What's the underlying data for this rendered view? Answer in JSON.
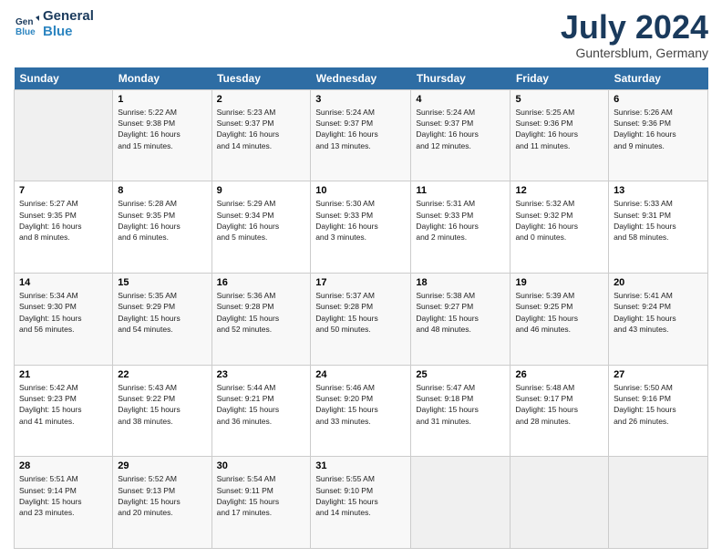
{
  "header": {
    "logo_line1": "General",
    "logo_line2": "Blue",
    "month": "July 2024",
    "location": "Guntersblum, Germany"
  },
  "weekdays": [
    "Sunday",
    "Monday",
    "Tuesday",
    "Wednesday",
    "Thursday",
    "Friday",
    "Saturday"
  ],
  "weeks": [
    [
      {
        "day": "",
        "info": ""
      },
      {
        "day": "1",
        "info": "Sunrise: 5:22 AM\nSunset: 9:38 PM\nDaylight: 16 hours\nand 15 minutes."
      },
      {
        "day": "2",
        "info": "Sunrise: 5:23 AM\nSunset: 9:37 PM\nDaylight: 16 hours\nand 14 minutes."
      },
      {
        "day": "3",
        "info": "Sunrise: 5:24 AM\nSunset: 9:37 PM\nDaylight: 16 hours\nand 13 minutes."
      },
      {
        "day": "4",
        "info": "Sunrise: 5:24 AM\nSunset: 9:37 PM\nDaylight: 16 hours\nand 12 minutes."
      },
      {
        "day": "5",
        "info": "Sunrise: 5:25 AM\nSunset: 9:36 PM\nDaylight: 16 hours\nand 11 minutes."
      },
      {
        "day": "6",
        "info": "Sunrise: 5:26 AM\nSunset: 9:36 PM\nDaylight: 16 hours\nand 9 minutes."
      }
    ],
    [
      {
        "day": "7",
        "info": "Sunrise: 5:27 AM\nSunset: 9:35 PM\nDaylight: 16 hours\nand 8 minutes."
      },
      {
        "day": "8",
        "info": "Sunrise: 5:28 AM\nSunset: 9:35 PM\nDaylight: 16 hours\nand 6 minutes."
      },
      {
        "day": "9",
        "info": "Sunrise: 5:29 AM\nSunset: 9:34 PM\nDaylight: 16 hours\nand 5 minutes."
      },
      {
        "day": "10",
        "info": "Sunrise: 5:30 AM\nSunset: 9:33 PM\nDaylight: 16 hours\nand 3 minutes."
      },
      {
        "day": "11",
        "info": "Sunrise: 5:31 AM\nSunset: 9:33 PM\nDaylight: 16 hours\nand 2 minutes."
      },
      {
        "day": "12",
        "info": "Sunrise: 5:32 AM\nSunset: 9:32 PM\nDaylight: 16 hours\nand 0 minutes."
      },
      {
        "day": "13",
        "info": "Sunrise: 5:33 AM\nSunset: 9:31 PM\nDaylight: 15 hours\nand 58 minutes."
      }
    ],
    [
      {
        "day": "14",
        "info": "Sunrise: 5:34 AM\nSunset: 9:30 PM\nDaylight: 15 hours\nand 56 minutes."
      },
      {
        "day": "15",
        "info": "Sunrise: 5:35 AM\nSunset: 9:29 PM\nDaylight: 15 hours\nand 54 minutes."
      },
      {
        "day": "16",
        "info": "Sunrise: 5:36 AM\nSunset: 9:28 PM\nDaylight: 15 hours\nand 52 minutes."
      },
      {
        "day": "17",
        "info": "Sunrise: 5:37 AM\nSunset: 9:28 PM\nDaylight: 15 hours\nand 50 minutes."
      },
      {
        "day": "18",
        "info": "Sunrise: 5:38 AM\nSunset: 9:27 PM\nDaylight: 15 hours\nand 48 minutes."
      },
      {
        "day": "19",
        "info": "Sunrise: 5:39 AM\nSunset: 9:25 PM\nDaylight: 15 hours\nand 46 minutes."
      },
      {
        "day": "20",
        "info": "Sunrise: 5:41 AM\nSunset: 9:24 PM\nDaylight: 15 hours\nand 43 minutes."
      }
    ],
    [
      {
        "day": "21",
        "info": "Sunrise: 5:42 AM\nSunset: 9:23 PM\nDaylight: 15 hours\nand 41 minutes."
      },
      {
        "day": "22",
        "info": "Sunrise: 5:43 AM\nSunset: 9:22 PM\nDaylight: 15 hours\nand 38 minutes."
      },
      {
        "day": "23",
        "info": "Sunrise: 5:44 AM\nSunset: 9:21 PM\nDaylight: 15 hours\nand 36 minutes."
      },
      {
        "day": "24",
        "info": "Sunrise: 5:46 AM\nSunset: 9:20 PM\nDaylight: 15 hours\nand 33 minutes."
      },
      {
        "day": "25",
        "info": "Sunrise: 5:47 AM\nSunset: 9:18 PM\nDaylight: 15 hours\nand 31 minutes."
      },
      {
        "day": "26",
        "info": "Sunrise: 5:48 AM\nSunset: 9:17 PM\nDaylight: 15 hours\nand 28 minutes."
      },
      {
        "day": "27",
        "info": "Sunrise: 5:50 AM\nSunset: 9:16 PM\nDaylight: 15 hours\nand 26 minutes."
      }
    ],
    [
      {
        "day": "28",
        "info": "Sunrise: 5:51 AM\nSunset: 9:14 PM\nDaylight: 15 hours\nand 23 minutes."
      },
      {
        "day": "29",
        "info": "Sunrise: 5:52 AM\nSunset: 9:13 PM\nDaylight: 15 hours\nand 20 minutes."
      },
      {
        "day": "30",
        "info": "Sunrise: 5:54 AM\nSunset: 9:11 PM\nDaylight: 15 hours\nand 17 minutes."
      },
      {
        "day": "31",
        "info": "Sunrise: 5:55 AM\nSunset: 9:10 PM\nDaylight: 15 hours\nand 14 minutes."
      },
      {
        "day": "",
        "info": ""
      },
      {
        "day": "",
        "info": ""
      },
      {
        "day": "",
        "info": ""
      }
    ]
  ]
}
